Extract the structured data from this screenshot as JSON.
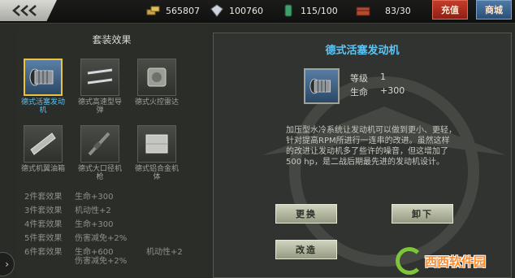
{
  "topbar": {
    "resources": [
      {
        "icon": "gold-bars-icon",
        "value": "565807"
      },
      {
        "icon": "diamond-icon",
        "value": "100760"
      },
      {
        "icon": "fuel-icon",
        "value": "115/100"
      },
      {
        "icon": "supply-crate-icon",
        "value": "83/30"
      }
    ],
    "recharge_label": "充值",
    "shop_label": "商城"
  },
  "left_panel": {
    "title": "套装效果",
    "items": [
      {
        "name": "德式活塞发动机",
        "icon": "piston-engine-icon",
        "selected": true
      },
      {
        "name": "德式高速型导弹",
        "icon": "missile-icon",
        "selected": false
      },
      {
        "name": "德式火控雷达",
        "icon": "fire-control-radar-icon",
        "selected": false
      },
      {
        "name": "德式机翼油箱",
        "icon": "wing-fuel-tank-icon",
        "selected": false
      },
      {
        "name": "德式大口径机枪",
        "icon": "machine-gun-icon",
        "selected": false
      },
      {
        "name": "德式铝合金机体",
        "icon": "aluminum-airframe-icon",
        "selected": false
      }
    ],
    "set_bonuses": [
      {
        "pieces": "2件套效果",
        "effect": "生命+300",
        "extra": ""
      },
      {
        "pieces": "3件套效果",
        "effect": "机动性+2",
        "extra": ""
      },
      {
        "pieces": "4件套效果",
        "effect": "生命+300",
        "extra": ""
      },
      {
        "pieces": "5件套效果",
        "effect": "伤害减免+2%",
        "extra": ""
      },
      {
        "pieces": "6件套效果",
        "effect": "生命+600",
        "extra": "机动性+2"
      }
    ],
    "set_bonus_6_line2": "伤害减免+2%"
  },
  "detail": {
    "title": "德式活塞发动机",
    "level_label": "等级",
    "level_value": "1",
    "hp_label": "生命",
    "hp_value": "+300",
    "description": "加压型水冷系统让发动机可以做到更小、更轻，针对提高RPM所进行一连串的改进。虽然这样的改进让发动机多了些许的噪音，但这增加了500 hp，是二战后期最先进的发动机设计。",
    "replace_label": "更换",
    "unequip_label": "卸下",
    "modify_label": "改造"
  },
  "watermark": {
    "text": "西西软件园"
  },
  "colors": {
    "accent_blue": "#5dc5f4",
    "selected_border": "#e9c33b",
    "recharge_red": "#c73a2b",
    "shop_blue": "#4e7aa8"
  }
}
